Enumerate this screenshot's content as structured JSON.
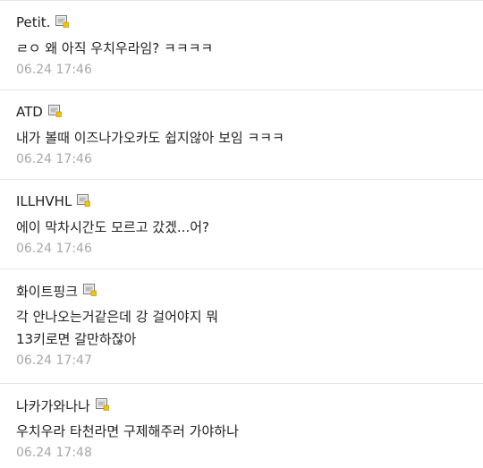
{
  "comments": [
    {
      "author": "Petit.",
      "lines": [
        "ㄹㅇ 왜 아직 우치우라임? ㅋㅋㅋㅋ"
      ],
      "time": "06.24 17:46"
    },
    {
      "author": "ATD",
      "lines": [
        "내가 볼때 이즈나가오카도 쉽지않아 보임 ㅋㅋㅋ"
      ],
      "time": "06.24 17:46"
    },
    {
      "author": "ILLHVHL",
      "lines": [
        "에이 막차시간도 모르고 갔겠...어?"
      ],
      "time": "06.24 17:46"
    },
    {
      "author": "화이트핑크",
      "lines": [
        "각 안나오는거같은데 강 걸어야지 뭐",
        "13키로면 갈만하잖아"
      ],
      "time": "06.24 17:47"
    },
    {
      "author": "나카가와나나",
      "lines": [
        "우치우라 타천라면 구제해주러 가야하나"
      ],
      "time": "06.24 17:48"
    }
  ],
  "icons": {
    "author_badge": "memo-icon"
  },
  "colors": {
    "text": "#222222",
    "timestamp": "#a8a8a8",
    "divider": "#e3e3e3"
  }
}
